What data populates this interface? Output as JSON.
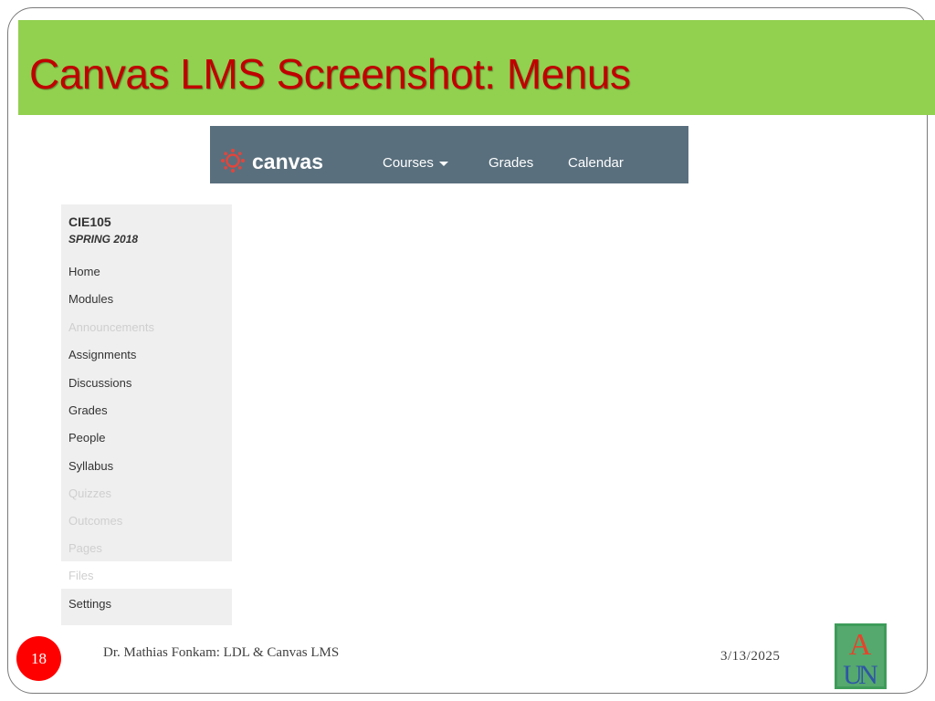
{
  "slide": {
    "title": "Canvas LMS Screenshot: Menus",
    "page_number": "18",
    "author": "Dr. Mathias Fonkam: LDL & Canvas LMS",
    "date": "3/13/2025",
    "logo_letters": "AUN"
  },
  "colors": {
    "title_bar": "#92d050",
    "title_text": "#c00000",
    "canvas_nav_bg": "#596f7d",
    "canvas_logo": "#e4443b",
    "menu_bg": "#efefef",
    "page_badge": "#ff0000"
  },
  "canvas_nav": {
    "logo_icon": "canvas-logo-icon",
    "wordmark": "canvas",
    "courses_label": "Courses",
    "grades_label": "Grades",
    "calendar_label": "Calendar"
  },
  "course_menu": {
    "course_code": "CIE105",
    "term": "SPRING 2018",
    "items": [
      {
        "label": "Home",
        "enabled": true
      },
      {
        "label": "Modules",
        "enabled": true
      },
      {
        "label": "Announcements",
        "enabled": false
      },
      {
        "label": "Assignments",
        "enabled": true
      },
      {
        "label": "Discussions",
        "enabled": true
      },
      {
        "label": "Grades",
        "enabled": true
      },
      {
        "label": "People",
        "enabled": true
      },
      {
        "label": "Syllabus",
        "enabled": true
      },
      {
        "label": "Quizzes",
        "enabled": false
      },
      {
        "label": "Outcomes",
        "enabled": false
      },
      {
        "label": "Pages",
        "enabled": false
      },
      {
        "label": "Files",
        "enabled": false
      },
      {
        "label": "Settings",
        "enabled": true
      }
    ]
  }
}
